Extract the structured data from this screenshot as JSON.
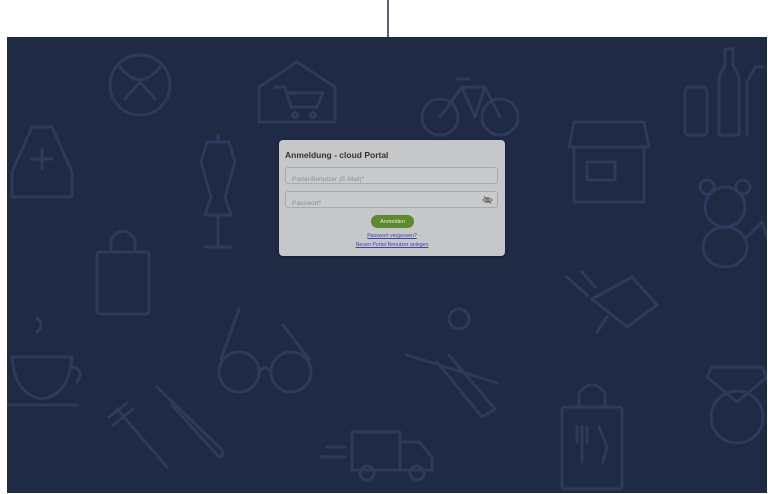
{
  "login_dialog": {
    "title": "Anmeldung - cloud Portal",
    "email_placeholder": "Portal-Benutzer (E-Mail)*",
    "password_placeholder": "Passwort*",
    "submit_label": "Anmelden",
    "forgot_password_link": "Passwort vergessen?",
    "new_user_link": "Neuen Portal-Benutzer anlegen"
  },
  "icons": {
    "password_toggle": "eye-off-icon",
    "cursor_indicator": "down-arrow-icon"
  },
  "colors": {
    "background": "#1f2a45",
    "background_pattern": "#2c3a5b",
    "dialog": "#c6c7c9",
    "primary_button": "#5b8a2f",
    "link": "#3c46a8"
  }
}
